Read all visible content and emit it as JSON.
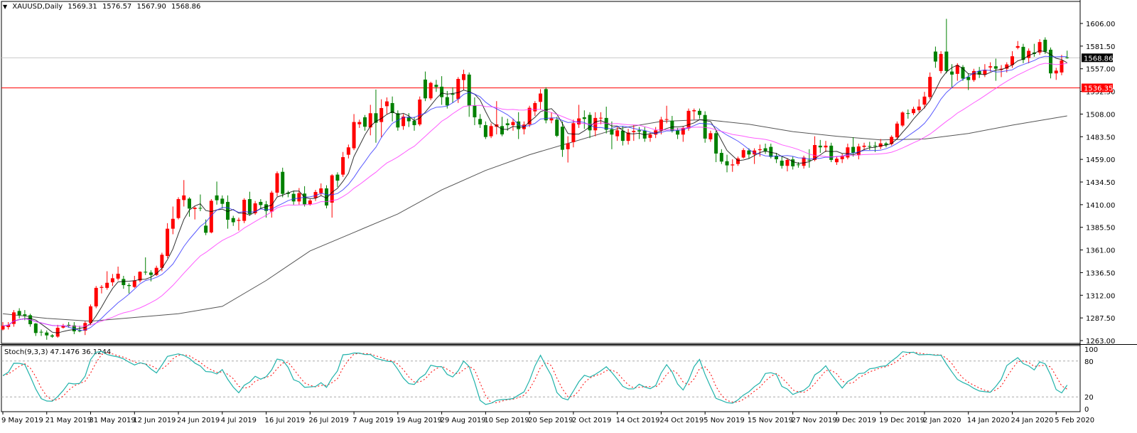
{
  "header": {
    "menu_icon": "triangle-down-icon",
    "symbol": "XAUUSD,Daily",
    "open": "1569.31",
    "high": "1576.57",
    "low": "1567.90",
    "close": "1568.86"
  },
  "stoch": {
    "label": "Stoch(9,3,3)",
    "k_value": "47.1476",
    "d_value": "36.1244",
    "k_period": 9,
    "d_period": 3,
    "slowing": 3,
    "k_color": "#20b2aa",
    "d_color": "#ff0000",
    "levels": [
      80,
      20
    ],
    "axis_labels": [
      {
        "value": 100,
        "label": "100"
      },
      {
        "value": 80,
        "label": "80"
      },
      {
        "value": 20,
        "label": "20"
      },
      {
        "value": 0,
        "label": "0"
      }
    ]
  },
  "chart_data": {
    "type": "candlestick",
    "symbol": "XAUUSD",
    "timeframe": "Daily",
    "ylim": [
      1263,
      1606
    ],
    "grid": false,
    "colors": {
      "bull": "#ff0000",
      "bear": "#008000",
      "axis": "#000000"
    },
    "y_ticks": [
      {
        "value": 1606.0,
        "label": "1606.00"
      },
      {
        "value": 1581.5,
        "label": "1581.50"
      },
      {
        "value": 1557.0,
        "label": "1557.00"
      },
      {
        "value": 1532.5,
        "label": "1532.50"
      },
      {
        "value": 1508.0,
        "label": "1508.00"
      },
      {
        "value": 1483.5,
        "label": "1483.50"
      },
      {
        "value": 1459.0,
        "label": "1459.00"
      },
      {
        "value": 1434.5,
        "label": "1434.50"
      },
      {
        "value": 1410.0,
        "label": "1410.00"
      },
      {
        "value": 1385.5,
        "label": "1385.50"
      },
      {
        "value": 1361.0,
        "label": "1361.00"
      },
      {
        "value": 1336.5,
        "label": "1336.50"
      },
      {
        "value": 1312.0,
        "label": "1312.00"
      },
      {
        "value": 1287.5,
        "label": "1287.50"
      },
      {
        "value": 1263.0,
        "label": "1263.00"
      }
    ],
    "x_ticks": [
      {
        "bar": 0,
        "label": "9 May 2019"
      },
      {
        "bar": 8,
        "label": "21 May 2019"
      },
      {
        "bar": 16,
        "label": "31 May 2019"
      },
      {
        "bar": 24,
        "label": "12 Jun 2019"
      },
      {
        "bar": 32,
        "label": "24 Jun 2019"
      },
      {
        "bar": 40,
        "label": "4 Jul 2019"
      },
      {
        "bar": 48,
        "label": "16 Jul 2019"
      },
      {
        "bar": 56,
        "label": "26 Jul 2019"
      },
      {
        "bar": 64,
        "label": "7 Aug 2019"
      },
      {
        "bar": 72,
        "label": "19 Aug 2019"
      },
      {
        "bar": 80,
        "label": "29 Aug 2019"
      },
      {
        "bar": 88,
        "label": "10 Sep 2019"
      },
      {
        "bar": 96,
        "label": "20 Sep 2019"
      },
      {
        "bar": 104,
        "label": "2 Oct 2019"
      },
      {
        "bar": 112,
        "label": "14 Oct 2019"
      },
      {
        "bar": 120,
        "label": "24 Oct 2019"
      },
      {
        "bar": 128,
        "label": "5 Nov 2019"
      },
      {
        "bar": 136,
        "label": "15 Nov 2019"
      },
      {
        "bar": 144,
        "label": "27 Nov 2019"
      },
      {
        "bar": 152,
        "label": "9 Dec 2019"
      },
      {
        "bar": 160,
        "label": "19 Dec 2019"
      },
      {
        "bar": 168,
        "label": "2 Jan 2020"
      },
      {
        "bar": 176,
        "label": "14 Jan 2020"
      },
      {
        "bar": 184,
        "label": "24 Jan 2020"
      },
      {
        "bar": 192,
        "label": "5 Feb 2020"
      }
    ],
    "hlines": [
      {
        "name": "resistance-line",
        "price": 1536.35,
        "label": "1536.35",
        "color": "#ff0000",
        "label_bg": "#ff0000",
        "label_fg": "#ffffff"
      },
      {
        "name": "bid-line",
        "price": 1568.86,
        "label": "1568.86",
        "color": "#c8c8c8",
        "label_bg": "#000000",
        "label_fg": "#ffffff"
      }
    ],
    "moving_averages": [
      {
        "type": "sma",
        "period": 5,
        "color": "#000000"
      },
      {
        "type": "sma",
        "period": 10,
        "color": "#3030ff"
      },
      {
        "type": "sma",
        "period": 21,
        "color": "#ff33ff"
      }
    ],
    "long_ma": {
      "color": "#555555",
      "bars": [
        0,
        8,
        16,
        24,
        32,
        40,
        48,
        56,
        64,
        72,
        80,
        88,
        96,
        104,
        112,
        120,
        128,
        136,
        144,
        152,
        160,
        168,
        176,
        184,
        192,
        194
      ],
      "values": [
        1292,
        1287,
        1284,
        1288,
        1292,
        1300,
        1328,
        1360,
        1380,
        1400,
        1426,
        1447,
        1464,
        1478,
        1492,
        1500,
        1502,
        1497,
        1489,
        1484,
        1480,
        1481,
        1487,
        1496,
        1504,
        1506
      ]
    },
    "candles_format": [
      "open",
      "high",
      "low",
      "close"
    ],
    "candles": [
      [
        1275,
        1283,
        1274,
        1279
      ],
      [
        1277.6,
        1283,
        1275,
        1280
      ],
      [
        1281,
        1296,
        1278,
        1293.5
      ],
      [
        1295,
        1298,
        1287,
        1290.4
      ],
      [
        1291.4,
        1296,
        1285,
        1290
      ],
      [
        1290.4,
        1292,
        1278,
        1280.7
      ],
      [
        1281.4,
        1282,
        1268,
        1271.2
      ],
      [
        1272.5,
        1275,
        1268,
        1272.4
      ],
      [
        1271.7,
        1274,
        1263.9,
        1268.6
      ],
      [
        1268.6,
        1270,
        1266,
        1267.3
      ],
      [
        1267.3,
        1280,
        1266,
        1276.8
      ],
      [
        1277,
        1281,
        1276,
        1279
      ],
      [
        1280,
        1283,
        1277,
        1279
      ],
      [
        1279.4,
        1283,
        1270,
        1273
      ],
      [
        1273.8,
        1279,
        1272,
        1273.5
      ],
      [
        1273.7,
        1284,
        1269,
        1282
      ],
      [
        1282,
        1302,
        1280,
        1300
      ],
      [
        1300,
        1322,
        1298,
        1320
      ],
      [
        1320,
        1323,
        1314,
        1321
      ],
      [
        1320,
        1338,
        1318,
        1325.5
      ],
      [
        1326,
        1335,
        1322,
        1330.4
      ],
      [
        1330,
        1343,
        1328,
        1335.3
      ],
      [
        1329.6,
        1333,
        1319,
        1323
      ],
      [
        1323,
        1325,
        1314,
        1322
      ],
      [
        1321,
        1333,
        1320,
        1328
      ],
      [
        1328,
        1338,
        1326,
        1337.4
      ],
      [
        1337.4,
        1353,
        1334,
        1336.6
      ],
      [
        1336.6,
        1339,
        1327,
        1334
      ],
      [
        1334,
        1344,
        1333,
        1341.7
      ],
      [
        1341.7,
        1358,
        1338,
        1355.8
      ],
      [
        1354.5,
        1390,
        1352,
        1384
      ],
      [
        1384,
        1408,
        1378,
        1394.7
      ],
      [
        1395.5,
        1418,
        1394,
        1416
      ],
      [
        1415,
        1436.6,
        1408,
        1420
      ],
      [
        1416.5,
        1418,
        1397,
        1405.8
      ],
      [
        1405.3,
        1408,
        1394,
        1406.6
      ],
      [
        1406.5,
        1421,
        1403,
        1406.3
      ],
      [
        1387.3,
        1394,
        1377,
        1379.6
      ],
      [
        1380,
        1416,
        1379,
        1414.2
      ],
      [
        1420,
        1435,
        1410,
        1414.8
      ],
      [
        1416.5,
        1420,
        1406,
        1410.9
      ],
      [
        1413,
        1420,
        1384,
        1393.7
      ],
      [
        1395.5,
        1398,
        1387,
        1391
      ],
      [
        1392.5,
        1396,
        1382,
        1393.5
      ],
      [
        1392.5,
        1417,
        1390,
        1415.3
      ],
      [
        1416,
        1424,
        1398,
        1400
      ],
      [
        1400.7,
        1414,
        1399,
        1411.4
      ],
      [
        1413,
        1416,
        1405,
        1409.6
      ],
      [
        1410.4,
        1414,
        1396,
        1403.2
      ],
      [
        1402.5,
        1425,
        1396,
        1423
      ],
      [
        1423,
        1446,
        1419,
        1444
      ],
      [
        1445.5,
        1450,
        1418,
        1421.7
      ],
      [
        1423,
        1425,
        1418,
        1421.7
      ],
      [
        1421.7,
        1425,
        1410,
        1413.5
      ],
      [
        1413.5,
        1428,
        1410,
        1422.5
      ],
      [
        1422,
        1430,
        1408,
        1410.4
      ],
      [
        1410.4,
        1416,
        1409,
        1414.5
      ],
      [
        1417.3,
        1426,
        1414,
        1423.7
      ],
      [
        1422.5,
        1433,
        1420,
        1427.6
      ],
      [
        1427.6,
        1431,
        1406,
        1409.1
      ],
      [
        1412.2,
        1443,
        1396,
        1441.7
      ],
      [
        1442.5,
        1445,
        1429,
        1436
      ],
      [
        1442.5,
        1467,
        1440,
        1461.4
      ],
      [
        1464,
        1475,
        1460,
        1472
      ],
      [
        1471,
        1508,
        1469,
        1499.4
      ],
      [
        1497,
        1502,
        1493,
        1499.4
      ],
      [
        1504.5,
        1507,
        1490,
        1494.3
      ],
      [
        1493.6,
        1518,
        1485,
        1508.9
      ],
      [
        1508.9,
        1534.5,
        1477,
        1498.6
      ],
      [
        1499.4,
        1524,
        1483,
        1514.5
      ],
      [
        1516.5,
        1526,
        1508,
        1521.7
      ],
      [
        1519.9,
        1527,
        1500,
        1509.1
      ],
      [
        1508.9,
        1512,
        1490,
        1493.5
      ],
      [
        1495,
        1508,
        1491,
        1505.3
      ],
      [
        1504.5,
        1509,
        1494,
        1500.2
      ],
      [
        1500.7,
        1505,
        1490,
        1496
      ],
      [
        1496.8,
        1527,
        1495,
        1523.7
      ],
      [
        1545.3,
        1554,
        1522,
        1525
      ],
      [
        1525,
        1543,
        1523,
        1541.7
      ],
      [
        1539.6,
        1545,
        1532,
        1537.3
      ],
      [
        1537.6,
        1549,
        1518,
        1526.3
      ],
      [
        1526.3,
        1533,
        1514,
        1517.3
      ],
      [
        1530,
        1537,
        1520,
        1528.9
      ],
      [
        1524.3,
        1548,
        1520,
        1546
      ],
      [
        1544.8,
        1556,
        1534,
        1551.2
      ],
      [
        1550.7,
        1553,
        1505,
        1517.3
      ],
      [
        1517.3,
        1526,
        1496,
        1504.5
      ],
      [
        1502.7,
        1508,
        1493,
        1496.8
      ],
      [
        1496,
        1500,
        1481,
        1483.2
      ],
      [
        1484,
        1498,
        1482,
        1495
      ],
      [
        1494.3,
        1522,
        1486,
        1496.8
      ],
      [
        1495,
        1505,
        1484,
        1486
      ],
      [
        1498,
        1503,
        1490,
        1496
      ],
      [
        1496,
        1503,
        1490,
        1499.4
      ],
      [
        1500,
        1510,
        1481,
        1491.7
      ],
      [
        1491.7,
        1500,
        1486,
        1496.6
      ],
      [
        1496.8,
        1517,
        1494,
        1514.8
      ],
      [
        1510.9,
        1522,
        1506,
        1519.9
      ],
      [
        1521.2,
        1535,
        1513,
        1530.2
      ],
      [
        1535,
        1537,
        1498,
        1501.2
      ],
      [
        1501.2,
        1510,
        1498,
        1503.3
      ],
      [
        1502,
        1505,
        1483,
        1484.5
      ],
      [
        1494.3,
        1500,
        1461.7,
        1469.4
      ],
      [
        1470,
        1484,
        1455.6,
        1476.3
      ],
      [
        1477.6,
        1502,
        1472,
        1498.1
      ],
      [
        1496.8,
        1518,
        1493,
        1503.3
      ],
      [
        1504.5,
        1512,
        1492,
        1502.7
      ],
      [
        1507.1,
        1510,
        1482,
        1490.4
      ],
      [
        1490.4,
        1510,
        1484,
        1503.8
      ],
      [
        1503.5,
        1510,
        1497,
        1504
      ],
      [
        1503.8,
        1516,
        1487,
        1491
      ],
      [
        1491.7,
        1500,
        1470,
        1485.8
      ],
      [
        1484,
        1494,
        1479,
        1490.4
      ],
      [
        1490,
        1495,
        1474,
        1479
      ],
      [
        1479,
        1492,
        1475,
        1488
      ],
      [
        1488.5,
        1496,
        1479,
        1489.8
      ],
      [
        1490.4,
        1494,
        1481,
        1489.2
      ],
      [
        1490,
        1494,
        1478,
        1481.5
      ],
      [
        1482.3,
        1488,
        1478,
        1485.8
      ],
      [
        1485.8,
        1494,
        1482,
        1490.4
      ],
      [
        1490,
        1505,
        1486,
        1502
      ],
      [
        1501.7,
        1517,
        1498,
        1502.5
      ],
      [
        1500.7,
        1506,
        1488,
        1490
      ],
      [
        1490.4,
        1493,
        1481,
        1485.8
      ],
      [
        1485.8,
        1495,
        1478,
        1493
      ],
      [
        1492.5,
        1514,
        1490,
        1511.5
      ],
      [
        1511,
        1514,
        1502,
        1512.2
      ],
      [
        1511.5,
        1514,
        1503,
        1507.1
      ],
      [
        1507,
        1511,
        1477,
        1481.5
      ],
      [
        1480.7,
        1490,
        1478,
        1487.3
      ],
      [
        1487.3,
        1490,
        1456,
        1465.3
      ],
      [
        1466,
        1470,
        1454,
        1456.6
      ],
      [
        1457,
        1464,
        1445,
        1452.5
      ],
      [
        1452.5,
        1459,
        1445.5,
        1453.5
      ],
      [
        1454,
        1462,
        1452,
        1460
      ],
      [
        1461,
        1471,
        1460,
        1469
      ],
      [
        1468.6,
        1471,
        1460,
        1464.3
      ],
      [
        1464.3,
        1471,
        1454,
        1468.6
      ],
      [
        1469,
        1475,
        1462,
        1470
      ],
      [
        1471,
        1476,
        1465,
        1468
      ],
      [
        1472.5,
        1476,
        1460,
        1461.7
      ],
      [
        1462.7,
        1466,
        1455,
        1459.1
      ],
      [
        1457.6,
        1462,
        1449,
        1452
      ],
      [
        1452,
        1460,
        1446,
        1458.4
      ],
      [
        1459,
        1462,
        1448,
        1451.5
      ],
      [
        1453.5,
        1456,
        1450,
        1453.2
      ],
      [
        1452,
        1463,
        1449,
        1461
      ],
      [
        1458.5,
        1470,
        1450,
        1458.3
      ],
      [
        1458.4,
        1484,
        1457,
        1474.5
      ],
      [
        1473.8,
        1480,
        1466,
        1472
      ],
      [
        1472,
        1479,
        1467,
        1473.8
      ],
      [
        1473.8,
        1477,
        1456,
        1458.4
      ],
      [
        1455.9,
        1462,
        1453,
        1459.7
      ],
      [
        1459.2,
        1465,
        1455,
        1462.8
      ],
      [
        1461,
        1476,
        1459,
        1472
      ],
      [
        1472.5,
        1483,
        1462,
        1466.1
      ],
      [
        1463.5,
        1476,
        1459,
        1473
      ],
      [
        1472.5,
        1477,
        1469,
        1473.8
      ],
      [
        1473.4,
        1478,
        1469,
        1473.2
      ],
      [
        1473.8,
        1478,
        1467,
        1473.5
      ],
      [
        1472.5,
        1481,
        1470,
        1476.3
      ],
      [
        1476.3,
        1478,
        1472,
        1474.6
      ],
      [
        1475.6,
        1485,
        1474,
        1483.3
      ],
      [
        1482.8,
        1500,
        1481,
        1497.7
      ],
      [
        1495.6,
        1511,
        1494,
        1509.7
      ],
      [
        1509,
        1513,
        1503,
        1508.9
      ],
      [
        1509,
        1516,
        1507,
        1513.5
      ],
      [
        1512.2,
        1524,
        1510,
        1516.1
      ],
      [
        1518.2,
        1532,
        1514,
        1526.9
      ],
      [
        1526.4,
        1553,
        1524,
        1548.2
      ],
      [
        1575.6,
        1581,
        1558,
        1564.8
      ],
      [
        1554.6,
        1576,
        1552,
        1573
      ],
      [
        1575.6,
        1611,
        1552,
        1554.6
      ],
      [
        1554,
        1562,
        1537,
        1550.7
      ],
      [
        1551.5,
        1563,
        1544,
        1561
      ],
      [
        1558.9,
        1561,
        1544,
        1546.4
      ],
      [
        1548.2,
        1552,
        1534,
        1544.8
      ],
      [
        1544.8,
        1557,
        1543,
        1554.6
      ],
      [
        1554.6,
        1559,
        1547,
        1550.7
      ],
      [
        1550.7,
        1562,
        1548,
        1555.8
      ],
      [
        1558.4,
        1564,
        1554,
        1559.7
      ],
      [
        1559.7,
        1568,
        1544,
        1557.1
      ],
      [
        1555.8,
        1561,
        1548,
        1557
      ],
      [
        1557.1,
        1564,
        1553,
        1561.7
      ],
      [
        1561,
        1576,
        1558,
        1570.5
      ],
      [
        1579.7,
        1587,
        1578,
        1581.5
      ],
      [
        1580.7,
        1584,
        1563,
        1566.6
      ],
      [
        1568.7,
        1579,
        1563,
        1576.4
      ],
      [
        1574.6,
        1584,
        1570,
        1573
      ],
      [
        1574.6,
        1589,
        1572,
        1585.9
      ],
      [
        1588.4,
        1591,
        1573,
        1575.6
      ],
      [
        1577.6,
        1580,
        1546.6,
        1552
      ],
      [
        1552,
        1558,
        1545,
        1555
      ],
      [
        1553,
        1572,
        1550,
        1566
      ],
      [
        1569.31,
        1576.57,
        1567.9,
        1568.86
      ]
    ]
  }
}
